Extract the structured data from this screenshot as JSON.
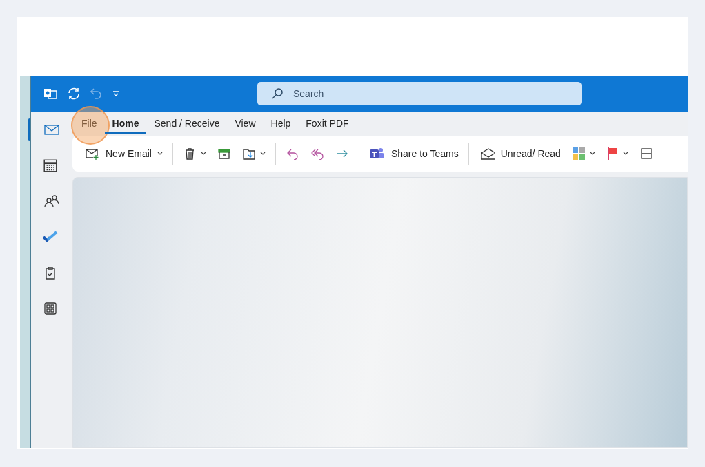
{
  "search": {
    "placeholder": "Search"
  },
  "menu_tabs": [
    {
      "label": "File",
      "selected": false,
      "highlighted": true
    },
    {
      "label": "Home",
      "selected": true,
      "highlighted": false
    },
    {
      "label": "Send / Receive",
      "selected": false,
      "highlighted": false
    },
    {
      "label": "View",
      "selected": false,
      "highlighted": false
    },
    {
      "label": "Help",
      "selected": false,
      "highlighted": false
    },
    {
      "label": "Foxit PDF",
      "selected": false,
      "highlighted": false
    }
  ],
  "nav": [
    {
      "selected": true
    },
    {
      "selected": false
    },
    {
      "selected": false
    },
    {
      "selected": false
    },
    {
      "selected": false
    },
    {
      "selected": false
    }
  ],
  "toolbar": [
    {
      "kind": "button",
      "label": "New Email",
      "dropdown": true
    },
    {
      "kind": "separator"
    },
    {
      "kind": "icon",
      "dropdown": true
    },
    {
      "kind": "icon",
      "dropdown": false
    },
    {
      "kind": "icon",
      "dropdown": true
    },
    {
      "kind": "separator"
    },
    {
      "kind": "icon",
      "dropdown": false
    },
    {
      "kind": "icon",
      "dropdown": false
    },
    {
      "kind": "icon",
      "dropdown": false
    },
    {
      "kind": "separator"
    },
    {
      "kind": "button",
      "label": "Share to Teams",
      "dropdown": false
    },
    {
      "kind": "separator"
    },
    {
      "kind": "button",
      "label": "Unread/ Read",
      "dropdown": false
    },
    {
      "kind": "icon",
      "dropdown": true
    },
    {
      "kind": "icon",
      "dropdown": true
    },
    {
      "kind": "icon",
      "dropdown": false
    }
  ]
}
